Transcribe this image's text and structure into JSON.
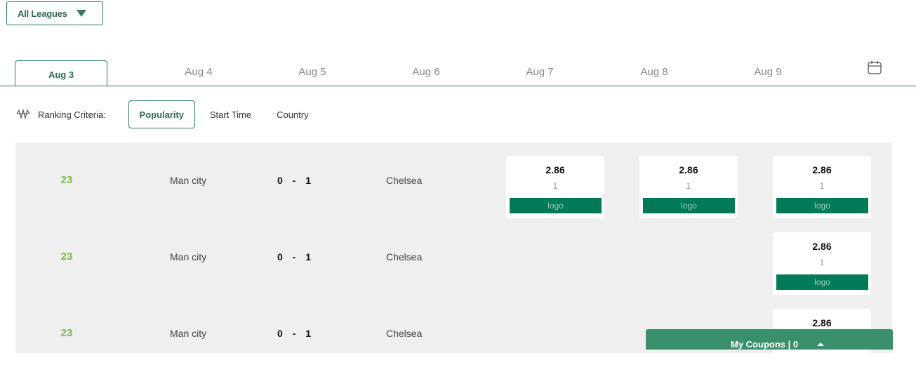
{
  "league_filter": {
    "label": "All Leagues"
  },
  "date_tabs": [
    "Aug 3",
    "Aug 4",
    "Aug 5",
    "Aug 6",
    "Aug 7",
    "Aug 8",
    "Aug 9"
  ],
  "ranking": {
    "label": "Ranking Criteria:",
    "options": [
      "Popularity",
      "Start Time",
      "Country"
    ],
    "selected": "Popularity"
  },
  "matches": [
    {
      "num": "23",
      "home": "Man city",
      "score": "0 - 1",
      "away": "Chelsea",
      "odds": [
        {
          "value": "2.86",
          "sub": "1",
          "logo": "logo"
        },
        {
          "value": "2.86",
          "sub": "1",
          "logo": "logo"
        },
        {
          "value": "2.86",
          "sub": "1",
          "logo": "logo"
        }
      ]
    },
    {
      "num": "23",
      "home": "Man city",
      "score": "0 - 1",
      "away": "Chelsea",
      "odds": [
        {
          "value": "2.86",
          "sub": "1",
          "logo": "logo"
        }
      ]
    },
    {
      "num": "23",
      "home": "Man city",
      "score": "0 - 1",
      "away": "Chelsea",
      "odds": [
        {
          "value": "2.86",
          "sub": "",
          "logo": ""
        }
      ]
    }
  ],
  "coupons": {
    "label": "My Coupons | 0"
  },
  "colors": {
    "accent": "#2e7d5b",
    "logo_bar": "#007a59",
    "number": "#7db94a",
    "coupon_bar": "#3a8f6c"
  },
  "icons": {
    "league_caret": "caret-down-icon",
    "calendar": "calendar-icon",
    "ranking": "ranking-icon",
    "coupons_caret": "caret-up-icon"
  }
}
